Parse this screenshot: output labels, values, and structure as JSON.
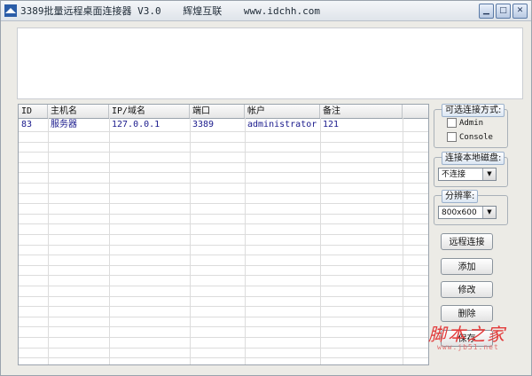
{
  "window": {
    "title": "3389批量远程桌面连接器 V3.0",
    "publisher": "辉煌互联",
    "website": "www.idchh.com"
  },
  "table": {
    "columns": [
      "ID",
      "主机名",
      "IP/域名",
      "端口",
      "帐户",
      "备注"
    ],
    "rows": [
      {
        "id": "83",
        "host": "服务器",
        "ip": "127.0.0.1",
        "port": "3389",
        "account": "administrator",
        "note": "121"
      }
    ]
  },
  "connect_mode": {
    "title": "可选连接方式:",
    "options": [
      "Admin",
      "Console"
    ]
  },
  "local_disk": {
    "title": "连接本地磁盘:",
    "selected": "不连接"
  },
  "resolution": {
    "title": "分辨率:",
    "selected": "800x600"
  },
  "buttons": {
    "remote_connect": "远程连接",
    "add": "添加",
    "edit": "修改",
    "delete": "删除",
    "save": "保存"
  },
  "watermark": {
    "text": "脚本之家",
    "url": "www.jb51.net"
  }
}
